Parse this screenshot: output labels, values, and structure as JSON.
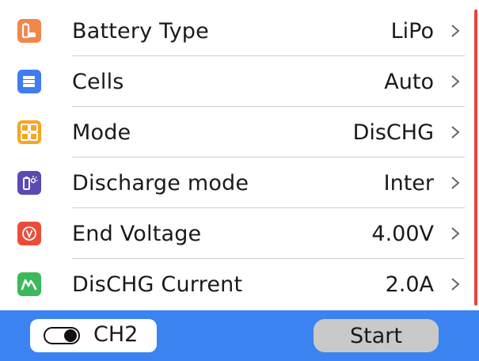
{
  "settings": [
    {
      "label": "Battery Type",
      "value": "LiPo",
      "icon": "battery-icon",
      "icon_color": "#f2874a"
    },
    {
      "label": "Cells",
      "value": "Auto",
      "icon": "cells-icon",
      "icon_color": "#3f7cf0"
    },
    {
      "label": "Mode",
      "value": "DisCHG",
      "icon": "mode-grid-icon",
      "icon_color": "#f5a623"
    },
    {
      "label": "Discharge mode",
      "value": "Inter",
      "icon": "discharge-bulb-icon",
      "icon_color": "#5a4ab3"
    },
    {
      "label": "End Voltage",
      "value": "4.00V",
      "icon": "voltage-icon",
      "icon_color": "#e94d3a"
    },
    {
      "label": "DisCHG Current",
      "value": "2.0A",
      "icon": "current-wave-icon",
      "icon_color": "#3cb95a"
    }
  ],
  "bottom": {
    "channel_label": "CH2",
    "start_label": "Start"
  },
  "colors": {
    "bottom_bar": "#3a83f1",
    "scrollbar": "#e8433a",
    "start_button": "#c9c9c9"
  }
}
